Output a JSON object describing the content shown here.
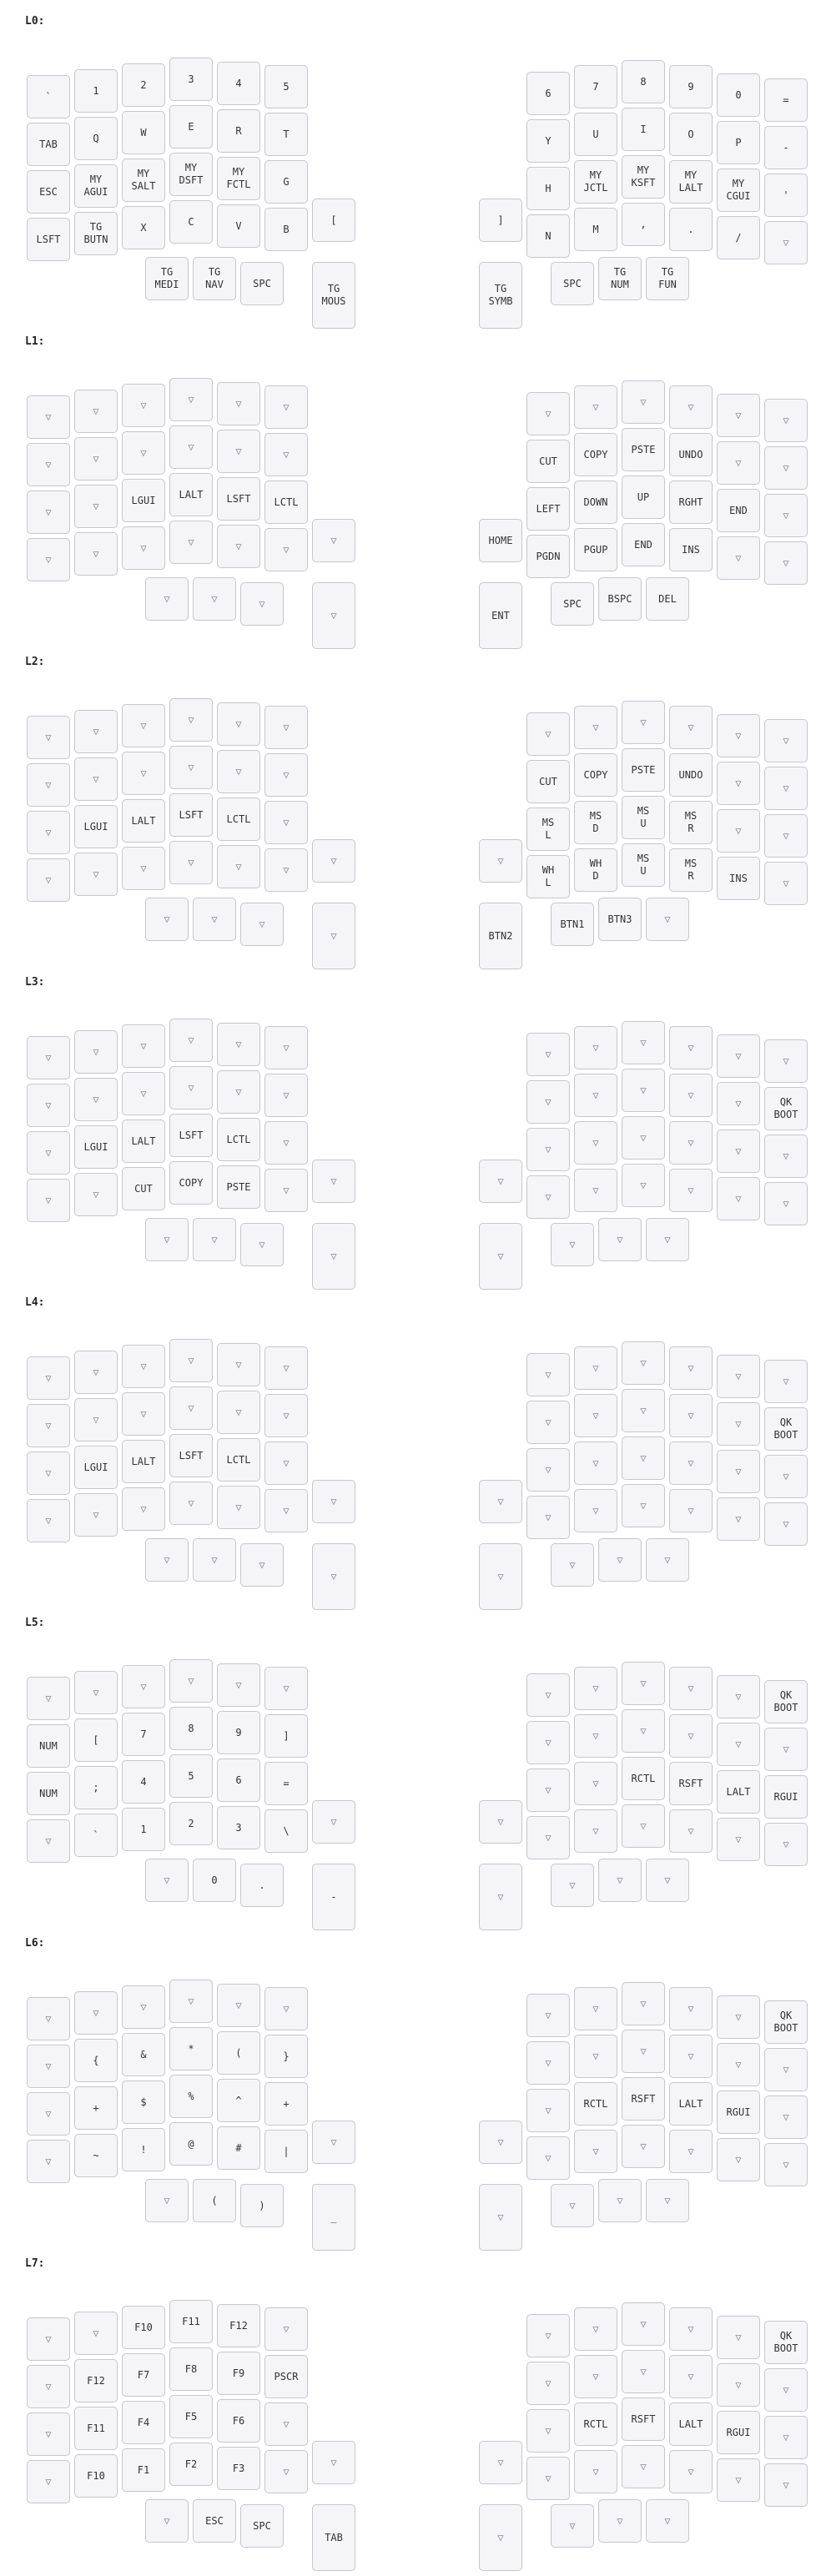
{
  "colors": {
    "key_fill": "#f5f5f7",
    "key_border": "#c6c6cc",
    "text": "#333333",
    "transparent_marker": "#8a8a95"
  },
  "transparent_symbol": "▽",
  "layers": [
    {
      "title": "L0:",
      "keys": [
        "`",
        "1",
        "2",
        "3",
        "4",
        "5",
        "TAB",
        "Q",
        "W",
        "E",
        "R",
        "T",
        "ESC",
        "MY\nAGUI",
        "MY\nSALT",
        "MY\nDSFT",
        "MY\nFCTL",
        "G",
        "LSFT",
        "TG\nBUTN",
        "X",
        "C",
        "V",
        "B",
        "[",
        "TG\nMEDI",
        "TG\nNAV",
        "SPC",
        "TG\nMOUS",
        "6",
        "7",
        "8",
        "9",
        "0",
        "=",
        "Y",
        "U",
        "I",
        "O",
        "P",
        "-",
        "H",
        "MY\nJCTL",
        "MY\nKSFT",
        "MY\nLALT",
        "MY\nCGUI",
        "'",
        "]",
        "N",
        "M",
        ",",
        ".",
        "/",
        "▽",
        "TG\nSYMB",
        "SPC",
        "TG\nNUM",
        "TG\nFUN"
      ]
    },
    {
      "title": "L1:",
      "keys": [
        "▽",
        "▽",
        "▽",
        "▽",
        "▽",
        "▽",
        "▽",
        "▽",
        "▽",
        "▽",
        "▽",
        "▽",
        "▽",
        "▽",
        "LGUI",
        "LALT",
        "LSFT",
        "LCTL",
        "▽",
        "▽",
        "▽",
        "▽",
        "▽",
        "▽",
        "▽",
        "▽",
        "▽",
        "▽",
        "▽",
        "▽",
        "▽",
        "▽",
        "▽",
        "▽",
        "▽",
        "CUT",
        "COPY",
        "PSTE",
        "UNDO",
        "▽",
        "▽",
        "LEFT",
        "DOWN",
        "UP",
        "RGHT",
        "END",
        "▽",
        "HOME",
        "PGDN",
        "PGUP",
        "END",
        "INS",
        "▽",
        "▽",
        "ENT",
        "SPC",
        "BSPC",
        "DEL"
      ]
    },
    {
      "title": "L2:",
      "keys": [
        "▽",
        "▽",
        "▽",
        "▽",
        "▽",
        "▽",
        "▽",
        "▽",
        "▽",
        "▽",
        "▽",
        "▽",
        "▽",
        "LGUI",
        "LALT",
        "LSFT",
        "LCTL",
        "▽",
        "▽",
        "▽",
        "▽",
        "▽",
        "▽",
        "▽",
        "▽",
        "▽",
        "▽",
        "▽",
        "▽",
        "▽",
        "▽",
        "▽",
        "▽",
        "▽",
        "▽",
        "CUT",
        "COPY",
        "PSTE",
        "UNDO",
        "▽",
        "▽",
        "MS\nL",
        "MS\nD",
        "MS\nU",
        "MS\nR",
        "▽",
        "▽",
        "▽",
        "WH\nL",
        "WH\nD",
        "MS\nU",
        "MS\nR",
        "INS",
        "▽",
        "BTN2",
        "BTN1",
        "BTN3",
        "▽"
      ]
    },
    {
      "title": "L3:",
      "keys": [
        "▽",
        "▽",
        "▽",
        "▽",
        "▽",
        "▽",
        "▽",
        "▽",
        "▽",
        "▽",
        "▽",
        "▽",
        "▽",
        "LGUI",
        "LALT",
        "LSFT",
        "LCTL",
        "▽",
        "▽",
        "▽",
        "CUT",
        "COPY",
        "PSTE",
        "▽",
        "▽",
        "▽",
        "▽",
        "▽",
        "▽",
        "▽",
        "▽",
        "▽",
        "▽",
        "▽",
        "▽",
        "▽",
        "▽",
        "▽",
        "▽",
        "▽",
        "QK\nBOOT",
        "▽",
        "▽",
        "▽",
        "▽",
        "▽",
        "▽",
        "▽",
        "▽",
        "▽",
        "▽",
        "▽",
        "▽",
        "▽",
        "▽",
        "▽",
        "▽",
        "▽"
      ]
    },
    {
      "title": "L4:",
      "keys": [
        "▽",
        "▽",
        "▽",
        "▽",
        "▽",
        "▽",
        "▽",
        "▽",
        "▽",
        "▽",
        "▽",
        "▽",
        "▽",
        "LGUI",
        "LALT",
        "LSFT",
        "LCTL",
        "▽",
        "▽",
        "▽",
        "▽",
        "▽",
        "▽",
        "▽",
        "▽",
        "▽",
        "▽",
        "▽",
        "▽",
        "▽",
        "▽",
        "▽",
        "▽",
        "▽",
        "▽",
        "▽",
        "▽",
        "▽",
        "▽",
        "▽",
        "QK\nBOOT",
        "▽",
        "▽",
        "▽",
        "▽",
        "▽",
        "▽",
        "▽",
        "▽",
        "▽",
        "▽",
        "▽",
        "▽",
        "▽",
        "▽",
        "▽",
        "▽",
        "▽"
      ]
    },
    {
      "title": "L5:",
      "keys": [
        "▽",
        "▽",
        "▽",
        "▽",
        "▽",
        "▽",
        "NUM",
        "[",
        "7",
        "8",
        "9",
        "]",
        "NUM",
        ";",
        "4",
        "5",
        "6",
        "=",
        "▽",
        "`",
        "1",
        "2",
        "3",
        "\\",
        "▽",
        "▽",
        "0",
        ".",
        "-",
        "▽",
        "▽",
        "▽",
        "▽",
        "▽",
        "QK\nBOOT",
        "▽",
        "▽",
        "▽",
        "▽",
        "▽",
        "▽",
        "▽",
        "▽",
        "RCTL",
        "RSFT",
        "LALT",
        "RGUI",
        "▽",
        "▽",
        "▽",
        "▽",
        "▽",
        "▽",
        "▽",
        "▽",
        "▽",
        "▽",
        "▽"
      ]
    },
    {
      "title": "L6:",
      "keys": [
        "▽",
        "▽",
        "▽",
        "▽",
        "▽",
        "▽",
        "▽",
        "{",
        "&",
        "*",
        "(",
        "}",
        "▽",
        "+",
        "$",
        "%",
        "^",
        "+",
        "▽",
        "~",
        "!",
        "@",
        "#",
        "|",
        "▽",
        "▽",
        "(",
        ")",
        "_",
        "▽",
        "▽",
        "▽",
        "▽",
        "▽",
        "QK\nBOOT",
        "▽",
        "▽",
        "▽",
        "▽",
        "▽",
        "▽",
        "▽",
        "RCTL",
        "RSFT",
        "LALT",
        "RGUI",
        "▽",
        "▽",
        "▽",
        "▽",
        "▽",
        "▽",
        "▽",
        "▽",
        "▽",
        "▽",
        "▽",
        "▽"
      ]
    },
    {
      "title": "L7:",
      "keys": [
        "▽",
        "▽",
        "F10",
        "F11",
        "F12",
        "▽",
        "▽",
        "F12",
        "F7",
        "F8",
        "F9",
        "PSCR",
        "▽",
        "F11",
        "F4",
        "F5",
        "F6",
        "▽",
        "▽",
        "F10",
        "F1",
        "F2",
        "F3",
        "▽",
        "▽",
        "▽",
        "ESC",
        "SPC",
        "TAB",
        "▽",
        "▽",
        "▽",
        "▽",
        "▽",
        "QK\nBOOT",
        "▽",
        "▽",
        "▽",
        "▽",
        "▽",
        "▽",
        "▽",
        "RCTL",
        "RSFT",
        "LALT",
        "RGUI",
        "▽",
        "▽",
        "▽",
        "▽",
        "▽",
        "▽",
        "▽",
        "▽",
        "▽",
        "▽",
        "▽",
        "▽"
      ]
    }
  ]
}
